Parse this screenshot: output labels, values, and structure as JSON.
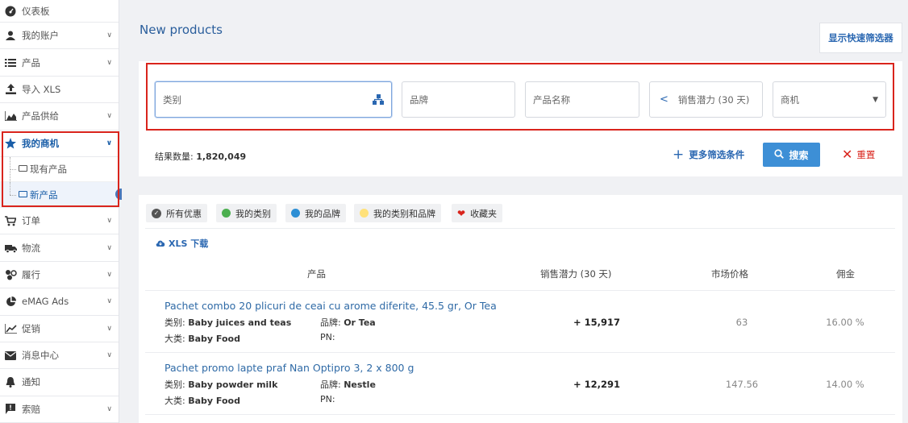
{
  "sidebar": {
    "items": [
      {
        "label": "仪表板",
        "icon": "dashboard-icon",
        "chevron": false
      },
      {
        "label": "我的账户",
        "icon": "user-icon",
        "chevron": true
      },
      {
        "label": "产品",
        "icon": "list-icon",
        "chevron": true
      },
      {
        "label": "导入 XLS",
        "icon": "upload-icon",
        "chevron": false
      },
      {
        "label": "产品供给",
        "icon": "area-chart-icon",
        "chevron": true
      },
      {
        "label": "我的商机",
        "icon": "star-icon",
        "chevron": true,
        "active": true
      }
    ],
    "subitems": [
      {
        "label": "现有产品"
      },
      {
        "label": "新产品",
        "current": true
      }
    ],
    "items_after": [
      {
        "label": "订单",
        "icon": "cart-icon",
        "chevron": true
      },
      {
        "label": "物流",
        "icon": "truck-icon",
        "chevron": true
      },
      {
        "label": "履行",
        "icon": "fulfillment-icon",
        "chevron": true
      },
      {
        "label": "eMAG Ads",
        "icon": "pie-icon",
        "chevron": true
      },
      {
        "label": "促销",
        "icon": "line-chart-icon",
        "chevron": true
      },
      {
        "label": "消息中心",
        "icon": "envelope-icon",
        "chevron": true
      },
      {
        "label": "通知",
        "icon": "bell-icon",
        "chevron": false
      },
      {
        "label": "索赔",
        "icon": "flag-icon",
        "chevron": true
      }
    ]
  },
  "page": {
    "title": "New products",
    "quick_filter_label": "显示快速筛选器"
  },
  "filters": {
    "category_placeholder": "类别",
    "brand_placeholder": "品牌",
    "product_name_placeholder": "产品名称",
    "sales_potential_label": "销售潜力 (30 天)",
    "opportunity_label": "商机",
    "result_label": "结果数量: ",
    "result_count": "1,820,049",
    "more_filters_label": "更多筛选条件",
    "search_label": "搜索",
    "reset_label": "重置"
  },
  "chips": [
    {
      "label": "所有优惠"
    },
    {
      "label": "我的类别",
      "color": "#4caf50"
    },
    {
      "label": "我的品牌",
      "color": "#2d8fd5"
    },
    {
      "label": "我的类别和品牌",
      "color": "#ffe17a"
    },
    {
      "label": "收藏夹",
      "color": "#d9241c"
    }
  ],
  "xls_download_label": "XLS 下载",
  "table": {
    "headers": {
      "product": "产品",
      "sales_potential": "销售潜力 (30 天)",
      "market_price": "市场价格",
      "commission": "佣金"
    },
    "category_prefix": "类别: ",
    "brand_prefix": "品牌: ",
    "main_category_prefix": "大类: ",
    "pn_prefix": "PN:",
    "rows": [
      {
        "name": "Pachet combo 20 plicuri de ceai cu arome diferite, 45.5 gr, Or Tea",
        "category": "Baby juices and teas",
        "brand": "Or Tea",
        "main_category": "Baby Food",
        "pn": "",
        "sales_potential": "+ 15,917",
        "market_price": "63",
        "commission": "16.00 %"
      },
      {
        "name": "Pachet promo lapte praf Nan Optipro 3, 2 x 800 g",
        "category": "Baby powder milk",
        "brand": "Nestle",
        "main_category": "Baby Food",
        "pn": "",
        "sales_potential": "+ 12,291",
        "market_price": "147.56",
        "commission": "14.00 %"
      }
    ]
  }
}
